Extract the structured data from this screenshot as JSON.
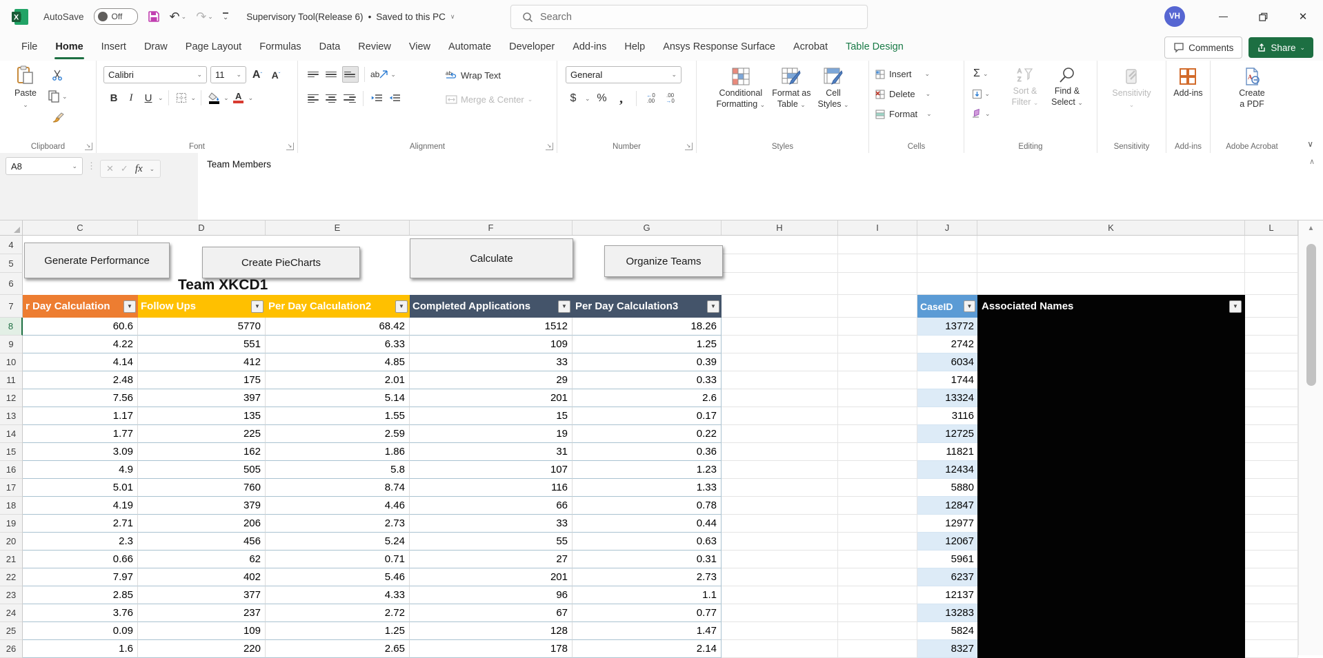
{
  "titlebar": {
    "autosave_label": "AutoSave",
    "autosave_state": "Off",
    "doc_title": "Supervisory Tool(Release 6)",
    "title_separator": "•",
    "save_status": "Saved to this PC",
    "search_placeholder": "Search",
    "avatar": "VH"
  },
  "tabs": {
    "items": [
      "File",
      "Home",
      "Insert",
      "Draw",
      "Page Layout",
      "Formulas",
      "Data",
      "Review",
      "View",
      "Automate",
      "Developer",
      "Add-ins",
      "Help",
      "Ansys Response Surface",
      "Acrobat",
      "Table Design"
    ],
    "active": "Home",
    "contextual": "Table Design",
    "comments": "Comments",
    "share": "Share"
  },
  "ribbon": {
    "paste": "Paste",
    "font_name": "Calibri",
    "font_size": "11",
    "wrap_text": "Wrap Text",
    "merge_center": "Merge & Center",
    "number_format": "General",
    "cond_fmt_1": "Conditional",
    "cond_fmt_2": "Formatting",
    "fmt_table_1": "Format as",
    "fmt_table_2": "Table",
    "cell_styles_1": "Cell",
    "cell_styles_2": "Styles",
    "insert": "Insert",
    "delete": "Delete",
    "format": "Format",
    "sort_1": "Sort &",
    "sort_2": "Filter",
    "find_1": "Find &",
    "find_2": "Select",
    "sensitivity": "Sensitivity",
    "addins": "Add-ins",
    "pdf_1": "Create",
    "pdf_2": "a PDF",
    "groups": [
      "Clipboard",
      "Font",
      "Alignment",
      "Number",
      "Styles",
      "Cells",
      "Editing",
      "Sensitivity",
      "Add-ins",
      "Adobe Acrobat"
    ]
  },
  "formula_bar": {
    "name_box": "A8",
    "formula": "Team Members"
  },
  "sheet": {
    "col_letters": [
      "C",
      "D",
      "E",
      "F",
      "G",
      "H",
      "I",
      "J",
      "K",
      "L"
    ],
    "visible_rows": {
      "first": 4,
      "last": 26
    },
    "macro_buttons": [
      "Generate Performance",
      "Create PieCharts",
      "Calculate",
      "Organize Teams"
    ],
    "team_title": "Team XKCD1",
    "table_headers": [
      "r Day Calculation",
      "Follow Ups",
      "Per Day Calculation2",
      "Completed Applications",
      "Per Day Calculation3"
    ],
    "caseid_header": "CaseID",
    "names_header": "Associated Names",
    "rows": [
      [
        "60.6",
        "5770",
        "68.42",
        "1512",
        "18.26",
        "13772"
      ],
      [
        "4.22",
        "551",
        "6.33",
        "109",
        "1.25",
        "2742"
      ],
      [
        "4.14",
        "412",
        "4.85",
        "33",
        "0.39",
        "6034"
      ],
      [
        "2.48",
        "175",
        "2.01",
        "29",
        "0.33",
        "1744"
      ],
      [
        "7.56",
        "397",
        "5.14",
        "201",
        "2.6",
        "13324"
      ],
      [
        "1.17",
        "135",
        "1.55",
        "15",
        "0.17",
        "3116"
      ],
      [
        "1.77",
        "225",
        "2.59",
        "19",
        "0.22",
        "12725"
      ],
      [
        "3.09",
        "162",
        "1.86",
        "31",
        "0.36",
        "11821"
      ],
      [
        "4.9",
        "505",
        "5.8",
        "107",
        "1.23",
        "12434"
      ],
      [
        "5.01",
        "760",
        "8.74",
        "116",
        "1.33",
        "5880"
      ],
      [
        "4.19",
        "379",
        "4.46",
        "66",
        "0.78",
        "12847"
      ],
      [
        "2.71",
        "206",
        "2.73",
        "33",
        "0.44",
        "12977"
      ],
      [
        "2.3",
        "456",
        "5.24",
        "55",
        "0.63",
        "12067"
      ],
      [
        "0.66",
        "62",
        "0.71",
        "27",
        "0.31",
        "5961"
      ],
      [
        "7.97",
        "402",
        "5.46",
        "201",
        "2.73",
        "6237"
      ],
      [
        "2.85",
        "377",
        "4.33",
        "96",
        "1.1",
        "12137"
      ],
      [
        "3.76",
        "237",
        "2.72",
        "67",
        "0.77",
        "13283"
      ],
      [
        "0.09",
        "109",
        "1.25",
        "128",
        "1.47",
        "5824"
      ],
      [
        "1.6",
        "220",
        "2.65",
        "178",
        "2.14",
        "8327"
      ]
    ]
  },
  "colors": {
    "accent_green": "#1d6f42",
    "header_orange": "#ED7D31",
    "header_amber": "#FFC000",
    "header_slate": "#44546A",
    "caseid_blue": "#5B9BD5",
    "caseid_band": "#DDEBF7",
    "redacted": "#030303",
    "save_icon_purple": "#c13fb0"
  }
}
